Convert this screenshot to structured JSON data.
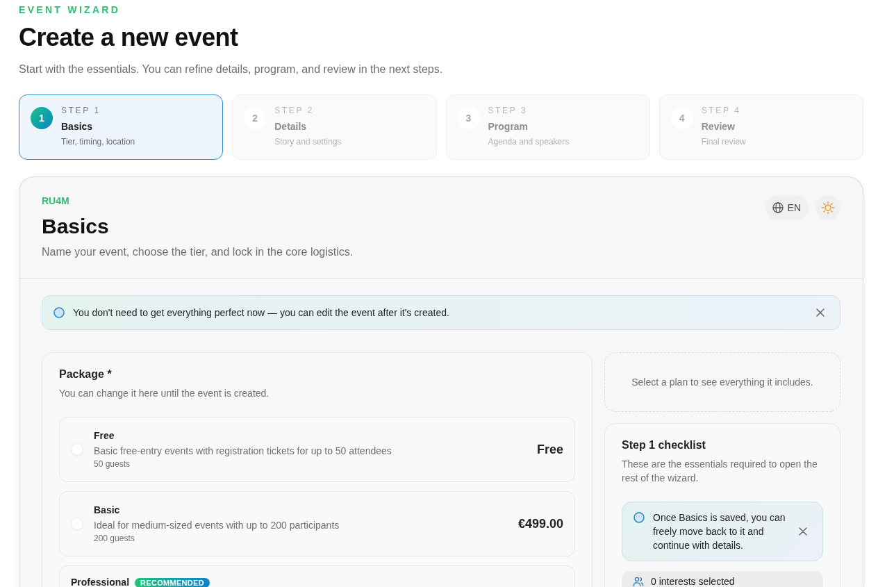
{
  "header": {
    "eyebrow": "EVENT WIZARD",
    "title": "Create a new event",
    "subtitle": "Start with the essentials. You can refine details, program, and review in the next steps."
  },
  "steps": [
    {
      "number": "1",
      "label": "STEP 1",
      "title": "Basics",
      "subtitle": "Tier, timing, location",
      "selected": true
    },
    {
      "number": "2",
      "label": "STEP 2",
      "title": "Details",
      "subtitle": "Story and settings",
      "selected": false
    },
    {
      "number": "3",
      "label": "STEP 3",
      "title": "Program",
      "subtitle": "Agenda and speakers",
      "selected": false
    },
    {
      "number": "4",
      "label": "STEP 4",
      "title": "Review",
      "subtitle": "Final review",
      "selected": false
    }
  ],
  "panel": {
    "code": "RU4M",
    "title": "Basics",
    "description": "Name your event, choose the tier, and lock in the core logistics.",
    "language": "EN"
  },
  "notice": {
    "text": "You don't need to get everything perfect now — you can edit the event after it's created."
  },
  "package": {
    "title": "Package *",
    "hint": "You can change it here until the event is created.",
    "options": [
      {
        "name": "Free",
        "description": "Basic free-entry events with registration tickets for up to 50 attendees",
        "guests": "50 guests",
        "price": "Free",
        "selected": false
      },
      {
        "name": "Basic",
        "description": "Ideal for medium-sized events with up to 200 participants",
        "guests": "200 guests",
        "price": "€499.00",
        "selected": false
      },
      {
        "name": "Professional",
        "badge": "RECOMMENDED"
      }
    ]
  },
  "plan_summary": {
    "text": "Select a plan to see everything it includes."
  },
  "checklist": {
    "title": "Step 1 checklist",
    "description": "These are the essentials required to open the rest of the wizard.",
    "notice": "Once Basics is saved, you can freely move back to it and continue with details.",
    "interests": "0 interests selected"
  }
}
